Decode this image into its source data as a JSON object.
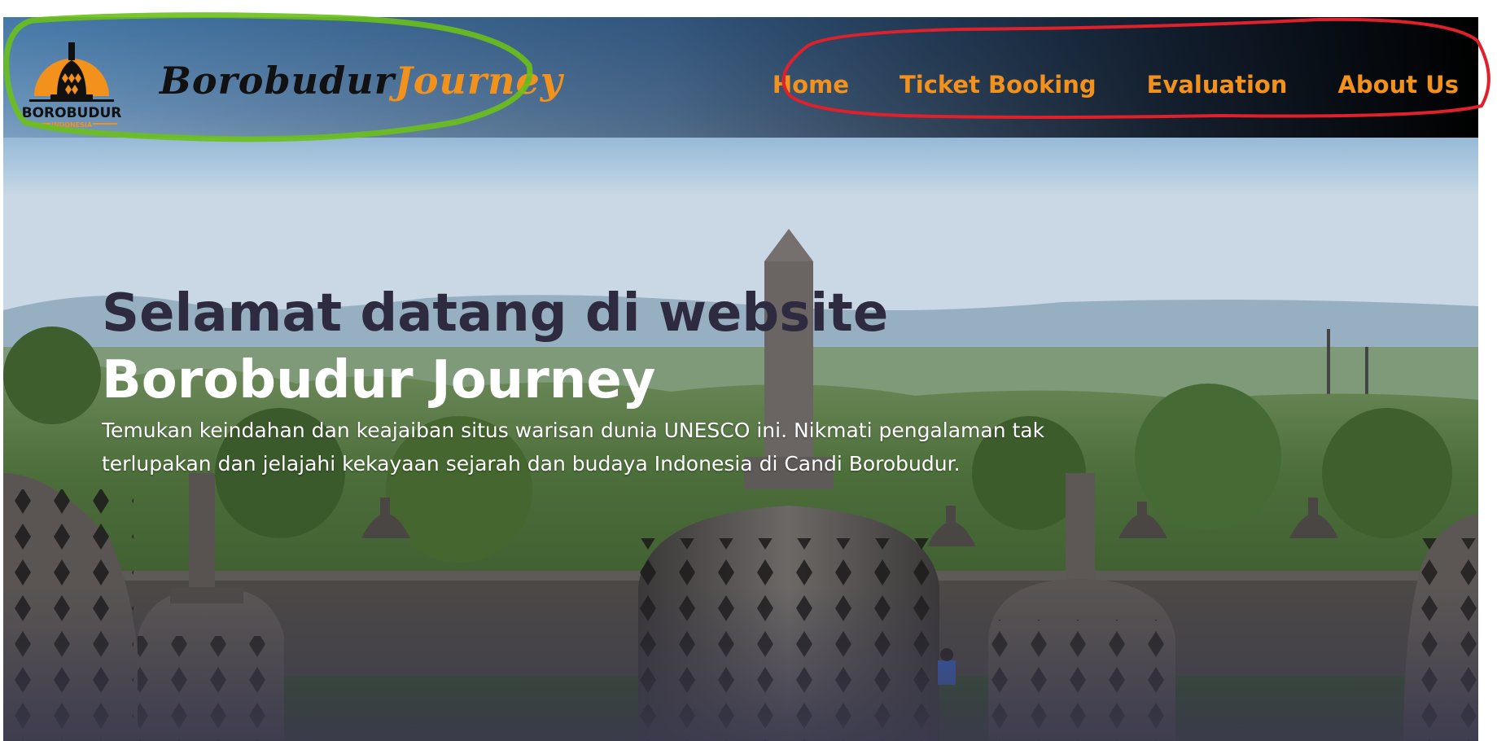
{
  "brand": {
    "logo_text": "BOROBUDUR",
    "logo_subtext": "INDONESIA",
    "name_part1": "Borobudur",
    "name_part2": "Journey"
  },
  "nav": {
    "items": [
      {
        "label": "Home"
      },
      {
        "label": "Ticket Booking"
      },
      {
        "label": "Evaluation"
      },
      {
        "label": "About Us"
      }
    ]
  },
  "hero": {
    "title_line1": "Selamat datang di website",
    "title_line2": "Borobudur Journey",
    "description": "Temukan keindahan dan keajaiban situs warisan dunia UNESCO ini. Nikmati pengalaman tak terlupakan dan jelajahi kekayaan sejarah dan budaya Indonesia di Candi Borobudur."
  },
  "colors": {
    "accent": "#f2911b",
    "title_dark": "#2e2a40",
    "annotation_green": "#6bc01a",
    "annotation_red": "#e0202a"
  },
  "icons": {
    "logo": "stupa-logo-icon"
  }
}
